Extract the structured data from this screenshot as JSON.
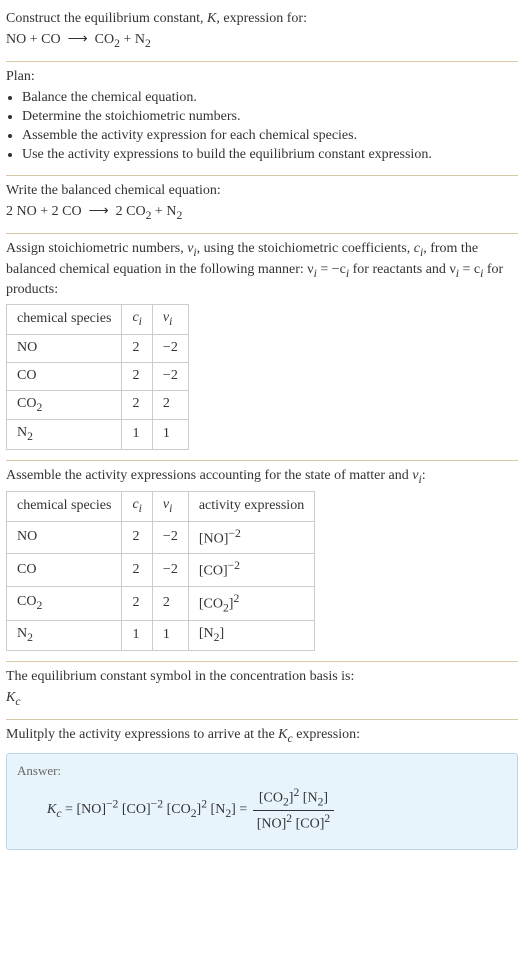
{
  "intro": {
    "line1_pre": "Construct the equilibrium constant, ",
    "line1_var": "K",
    "line1_post": ", expression for:",
    "eq_unbalanced_html": "NO + CO &nbsp;⟶&nbsp; CO<sub>2</sub> + N<sub>2</sub>"
  },
  "plan": {
    "heading": "Plan:",
    "items": [
      "Balance the chemical equation.",
      "Determine the stoichiometric numbers.",
      "Assemble the activity expression for each chemical species.",
      "Use the activity expressions to build the equilibrium constant expression."
    ]
  },
  "balanced": {
    "heading": "Write the balanced chemical equation:",
    "eq_html": "2 NO + 2 CO &nbsp;⟶&nbsp; 2 CO<sub>2</sub> + N<sub>2</sub>"
  },
  "stoich": {
    "text_pre": "Assign stoichiometric numbers, ",
    "nu": "ν",
    "text_mid1": ", using the stoichiometric coefficients, ",
    "ci": "c",
    "text_mid2": ", from the balanced chemical equation in the following manner: ",
    "rule_react_html": "ν<sub><i>i</i></sub> = −c<sub><i>i</i></sub>",
    "text_mid3": " for reactants and ",
    "rule_prod_html": "ν<sub><i>i</i></sub> = c<sub><i>i</i></sub>",
    "text_mid4": " for products:",
    "headers": {
      "species": "chemical species",
      "ci_html": "<i>c<sub>i</sub></i>",
      "nu_html": "<i>ν<sub>i</sub></i>"
    },
    "rows": [
      {
        "sp": "NO",
        "c": "2",
        "nu": "−2"
      },
      {
        "sp": "CO",
        "c": "2",
        "nu": "−2"
      },
      {
        "sp_html": "CO<sub>2</sub>",
        "c": "2",
        "nu": "2"
      },
      {
        "sp_html": "N<sub>2</sub>",
        "c": "1",
        "nu": "1"
      }
    ]
  },
  "activity": {
    "heading_html": "Assemble the activity expressions accounting for the state of matter and <i>ν<sub>i</sub></i>:",
    "headers": {
      "species": "chemical species",
      "ci_html": "<i>c<sub>i</sub></i>",
      "nu_html": "<i>ν<sub>i</sub></i>",
      "act": "activity expression"
    },
    "rows": [
      {
        "sp": "NO",
        "c": "2",
        "nu": "−2",
        "act_html": "[NO]<sup>−2</sup>"
      },
      {
        "sp": "CO",
        "c": "2",
        "nu": "−2",
        "act_html": "[CO]<sup>−2</sup>"
      },
      {
        "sp_html": "CO<sub>2</sub>",
        "c": "2",
        "nu": "2",
        "act_html": "[CO<sub>2</sub>]<sup>2</sup>"
      },
      {
        "sp_html": "N<sub>2</sub>",
        "c": "1",
        "nu": "1",
        "act_html": "[N<sub>2</sub>]"
      }
    ]
  },
  "symbol": {
    "heading": "The equilibrium constant symbol in the concentration basis is:",
    "kc_html": "<i>K<sub>c</sub></i>"
  },
  "final": {
    "heading_html": "Mulitply the activity expressions to arrive at the <i>K<sub>c</sub></i> expression:",
    "answer_label": "Answer:",
    "kc_html": "<i>K<sub>c</sub></i>",
    "lhs_html": "[NO]<sup>−2</sup> [CO]<sup>−2</sup> [CO<sub>2</sub>]<sup>2</sup> [N<sub>2</sub>]",
    "frac_num_html": "[CO<sub>2</sub>]<sup>2</sup> [N<sub>2</sub>]",
    "frac_den_html": "[NO]<sup>2</sup> [CO]<sup>2</sup>"
  }
}
